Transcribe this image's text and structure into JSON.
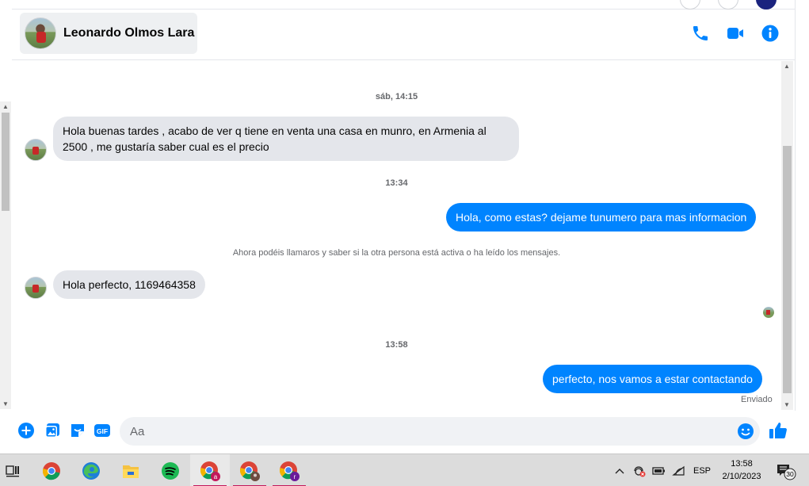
{
  "header": {
    "contact_name": "Leonardo Olmos Lara",
    "icons": [
      "phone-icon",
      "video-camera-icon",
      "info-icon"
    ],
    "accent_color": "#0084ff"
  },
  "conversation": {
    "timestamp_1": "sáb, 14:15",
    "msg_1": "Hola buenas tardes , acabo de ver q tiene en venta una casa en munro,  en Armenia al 2500 , me gustaría saber cual es el precio",
    "timestamp_2": "13:34",
    "msg_2": "Hola, como estas? dejame tunumero para mas informacion",
    "system_notice": "Ahora podéis llamaros y saber si la otra persona está activa o ha leído los mensajes.",
    "msg_3": "Hola perfecto,  1169464358",
    "timestamp_3": "13:58",
    "msg_4": "perfecto, nos vamos a estar contactando",
    "sent_status": "Enviado",
    "incoming_color": "#e4e6eb",
    "outgoing_color": "#0084ff"
  },
  "composer": {
    "placeholder": "Aa",
    "icons": [
      "plus-icon",
      "photo-icon",
      "sticker-icon",
      "gif-icon",
      "emoji-icon",
      "thumbs-up-icon"
    ],
    "gif_label": "GIF"
  },
  "taskbar": {
    "apps": [
      "task-view-icon",
      "chrome-icon",
      "edge-icon",
      "file-explorer-icon",
      "spotify-icon",
      "chrome-profile-a-icon",
      "chrome-profile-b-icon",
      "chrome-profile-r-icon"
    ],
    "profile_a_letter": "a",
    "profile_r_letter": "r",
    "language": "ESP",
    "time": "13:58",
    "date": "2/10/2023",
    "notification_count": "30"
  }
}
